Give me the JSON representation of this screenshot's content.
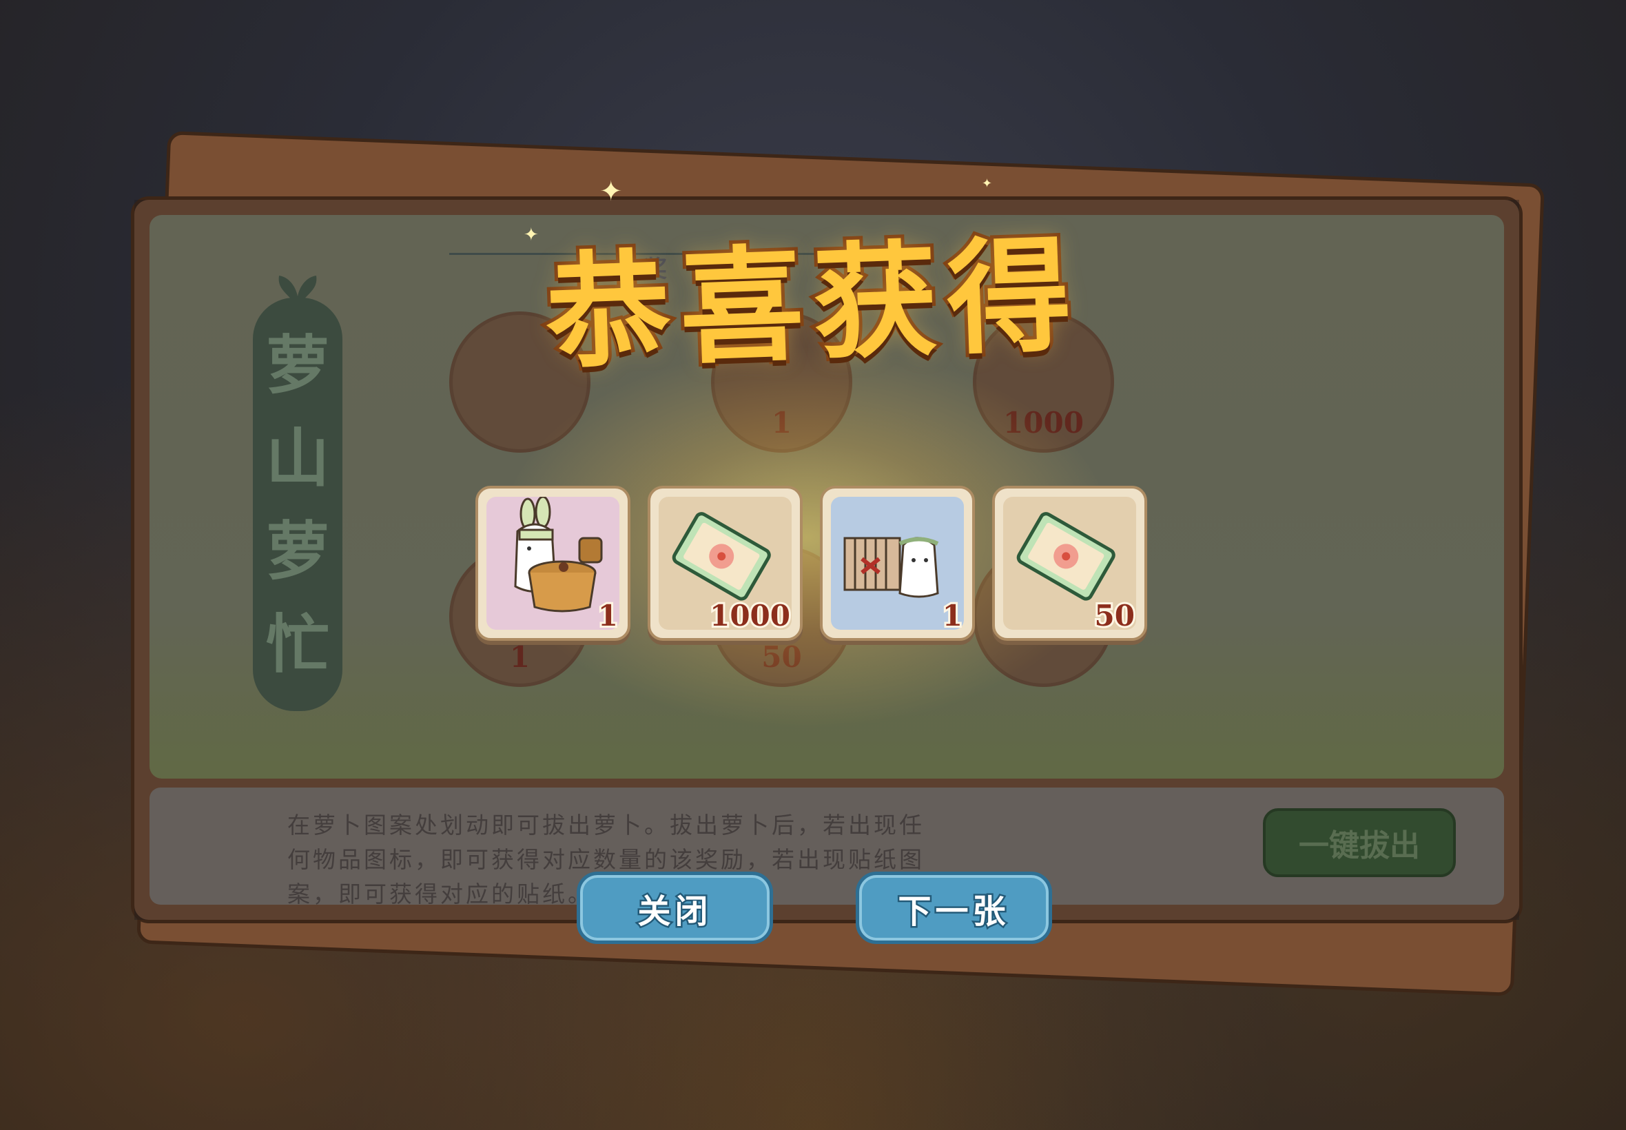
{
  "modal": {
    "title": "恭喜获得",
    "rewards": [
      {
        "item": "rabbit-with-wooden-tub",
        "count": "1",
        "bg": "#e6c9d8"
      },
      {
        "item": "flower-ticket",
        "count": "1000",
        "bg": "#e3cfae"
      },
      {
        "item": "rabbit-with-fence-scene",
        "count": "1",
        "bg": "#b7cbe2"
      },
      {
        "item": "flower-ticket",
        "count": "50",
        "bg": "#e3cfae"
      }
    ],
    "close_label": "关闭",
    "next_label": "下一张"
  },
  "board": {
    "banner_title": [
      "萝",
      "山",
      "萝",
      "忙"
    ],
    "prize_strip_text": "中奖　　最高",
    "slot_counts": [
      "1",
      "1000",
      "1",
      "50"
    ],
    "description": "在萝卜图案处划动即可拔出萝卜。拔出萝卜后，若出现任何物品图标，即可获得对应数量的该奖励，若出现贴纸图案，即可获得对应的贴纸。",
    "quick_pull_label": "一键拔出"
  },
  "colors": {
    "title_fill": "#ffc73d",
    "title_stroke": "#7a3a12",
    "button_blue": "#4f9cc2",
    "count_red": "#8c2e1c"
  }
}
